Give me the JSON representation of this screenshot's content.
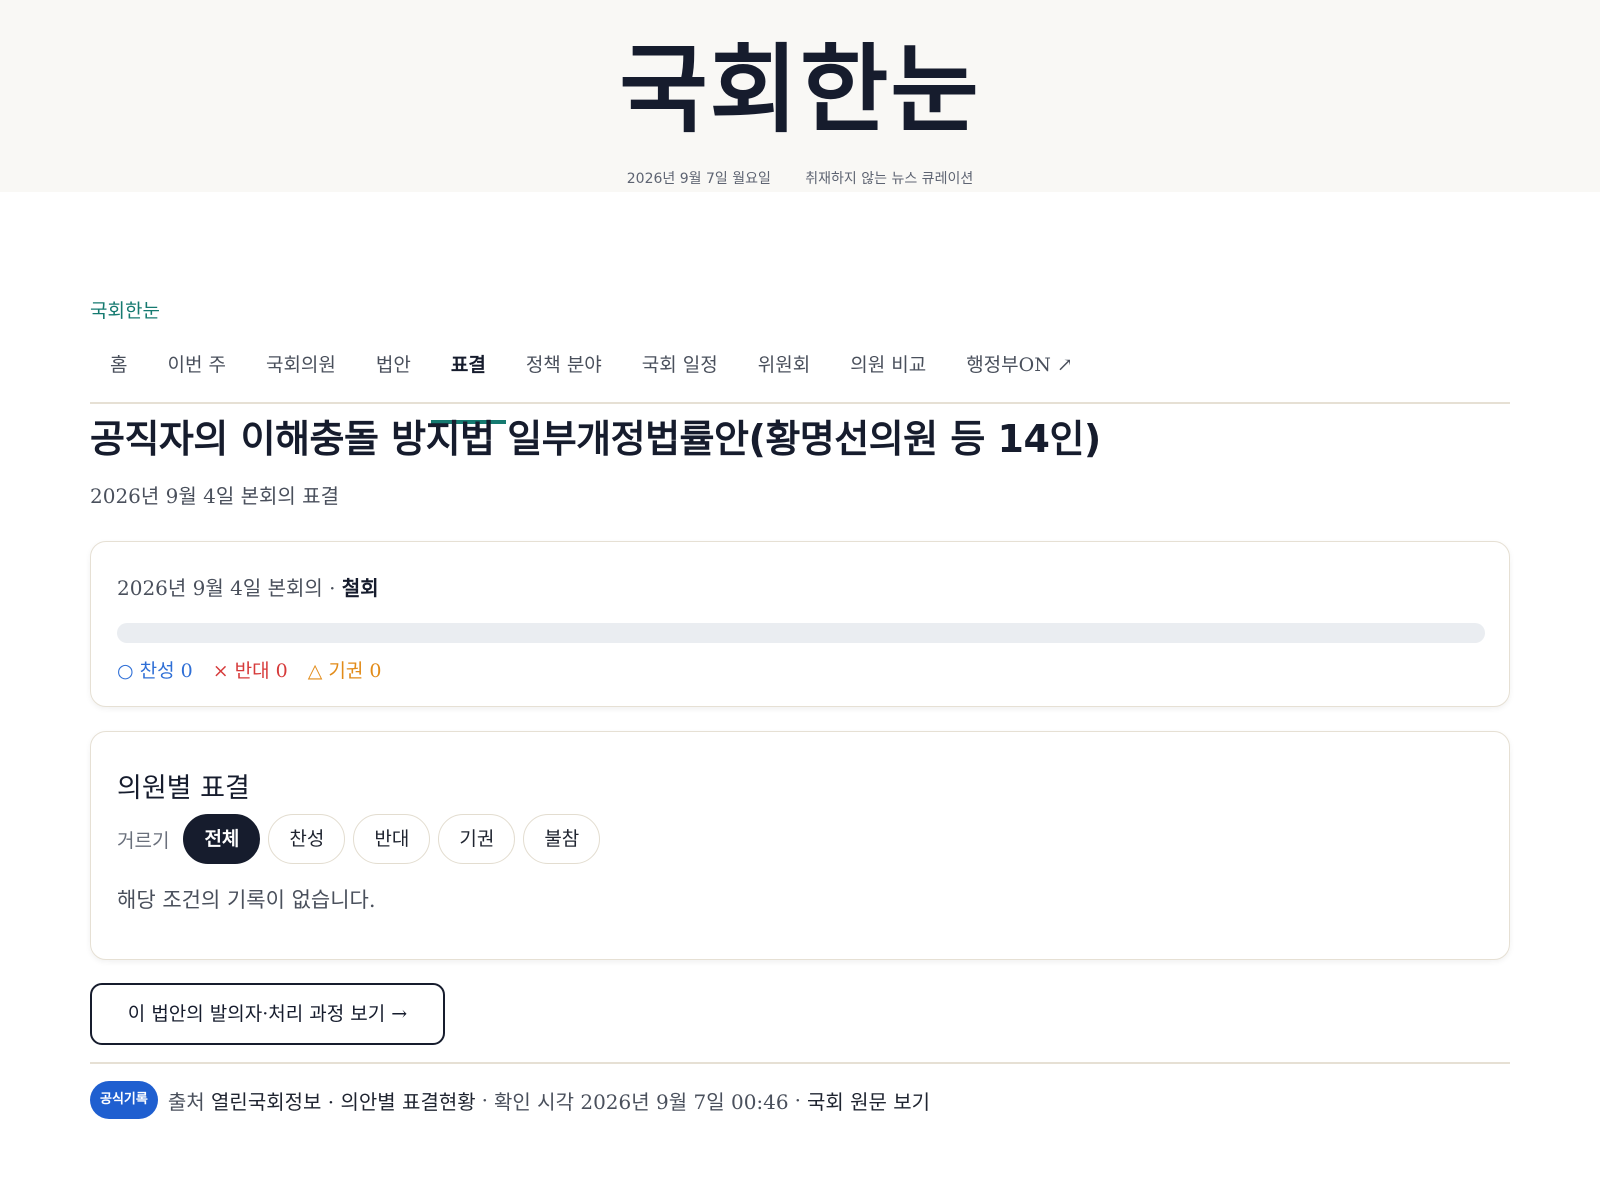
{
  "masthead": {
    "logo": "국회한눈",
    "date": "2026년 9월 7일 월요일",
    "tagline": "취재하지 않는 뉴스 큐레이션"
  },
  "brand": "국회한눈",
  "nav": {
    "items": [
      {
        "label": "홈"
      },
      {
        "label": "이번 주"
      },
      {
        "label": "국회의원"
      },
      {
        "label": "법안"
      },
      {
        "label": "표결"
      },
      {
        "label": "정책 분야"
      },
      {
        "label": "국회 일정"
      },
      {
        "label": "위원회"
      },
      {
        "label": "의원 비교"
      },
      {
        "label": "행정부ON ↗"
      }
    ],
    "active": "표결"
  },
  "page": {
    "title": "공직자의 이해충돌 방지법 일부개정법률안(황명선의원 등 14인)",
    "subtitle": "2026년 9월 4일 본회의 표결"
  },
  "vote_summary": {
    "session": "2026년 9월 4일 본회의 · ",
    "status": "철회",
    "yes_label": "○ 찬성 0",
    "no_label": "× 반대 0",
    "abstain_label": "△ 기권 0",
    "yes": 0,
    "no": 0,
    "abstain": 0,
    "colors": {
      "yes": "#2f6fd6",
      "no": "#d63a3a",
      "abstain": "#e28b18"
    }
  },
  "member_votes": {
    "heading": "의원별 표결",
    "filter_label": "거르기",
    "filters": [
      "전체",
      "찬성",
      "반대",
      "기권",
      "불참"
    ],
    "active_filter": "전체",
    "empty_message": "해당 조건의 기록이 없습니다."
  },
  "bill_link_label": "이 법안의 발의자·처리 과정 보기 →",
  "footer": {
    "badge": "공식기록",
    "source_prefix": "출처",
    "source": "열린국회정보 · 의안별 표결현황",
    "checked_prefix": "확인 시각",
    "checked_time": "2026년 9월 7일 00:46",
    "original_link": "국회 원문 보기"
  }
}
